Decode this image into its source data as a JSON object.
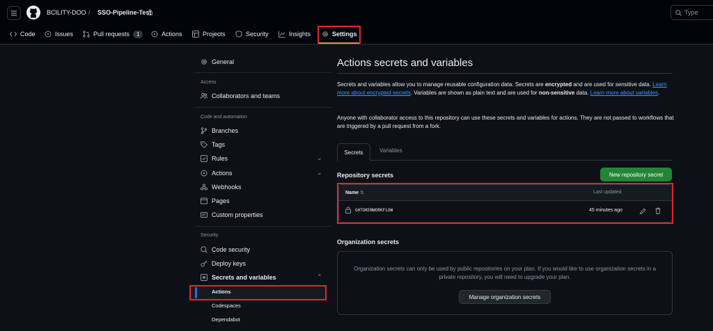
{
  "header": {
    "owner": "BCILITY-DOO",
    "separator": "/",
    "repo": "SSO-Pipeline-Test",
    "search_label": "Type"
  },
  "tabs": [
    {
      "label": "Code"
    },
    {
      "label": "Issues"
    },
    {
      "label": "Pull requests",
      "count": "1"
    },
    {
      "label": "Actions"
    },
    {
      "label": "Projects"
    },
    {
      "label": "Security"
    },
    {
      "label": "Insights"
    },
    {
      "label": "Settings"
    }
  ],
  "sidebar": {
    "general": "General",
    "access_heading": "Access",
    "collaborators": "Collaborators and teams",
    "code_heading": "Code and automation",
    "branches": "Branches",
    "tags": "Tags",
    "rules": "Rules",
    "actions": "Actions",
    "webhooks": "Webhooks",
    "pages": "Pages",
    "custom_properties": "Custom properties",
    "security_heading": "Security",
    "code_security": "Code security",
    "deploy_keys": "Deploy keys",
    "secrets_vars": "Secrets and variables",
    "sub_actions": "Actions",
    "sub_codespaces": "Codespaces",
    "sub_dependabot": "Dependabot"
  },
  "main": {
    "title": "Actions secrets and variables",
    "p1_a": "Secrets and variables allow you to manage reusable configuration data. Secrets are ",
    "p1_b": "encrypted",
    "p1_c": " and are used for sensitive data. ",
    "p1_link1": "Learn more about encrypted secrets",
    "p1_d": ". Variables are shown as plain text and are used for ",
    "p1_e": "non-sensitive",
    "p1_f": " data. ",
    "p1_link2": "Learn more about variables",
    "p1_g": ".",
    "p2": "Anyone with collaborator access to this repository can use these secrets and variables for actions. They are not passed to workflows that are triggered by a pull request from a fork.",
    "tab_secrets": "Secrets",
    "tab_variables": "Variables",
    "repo_secrets_title": "Repository secrets",
    "new_secret_button": "New repository secret",
    "col_name": "Name",
    "col_updated": "Last updated",
    "secret_row": {
      "name": "GHTOKENWORKFLOW",
      "updated": "45 minutes ago"
    },
    "org_secrets_title": "Organization secrets",
    "org_text": "Organization secrets can only be used by public repositories on your plan. If you would like to use organization secrets in a private repository, you will need to upgrade your plan.",
    "manage_button": "Manage organization secrets"
  },
  "colors": {
    "background": "#0d1117",
    "header": "#010409",
    "accent_link": "#4493f8",
    "primary_button": "#238636",
    "highlight_outline": "#e5252d"
  }
}
